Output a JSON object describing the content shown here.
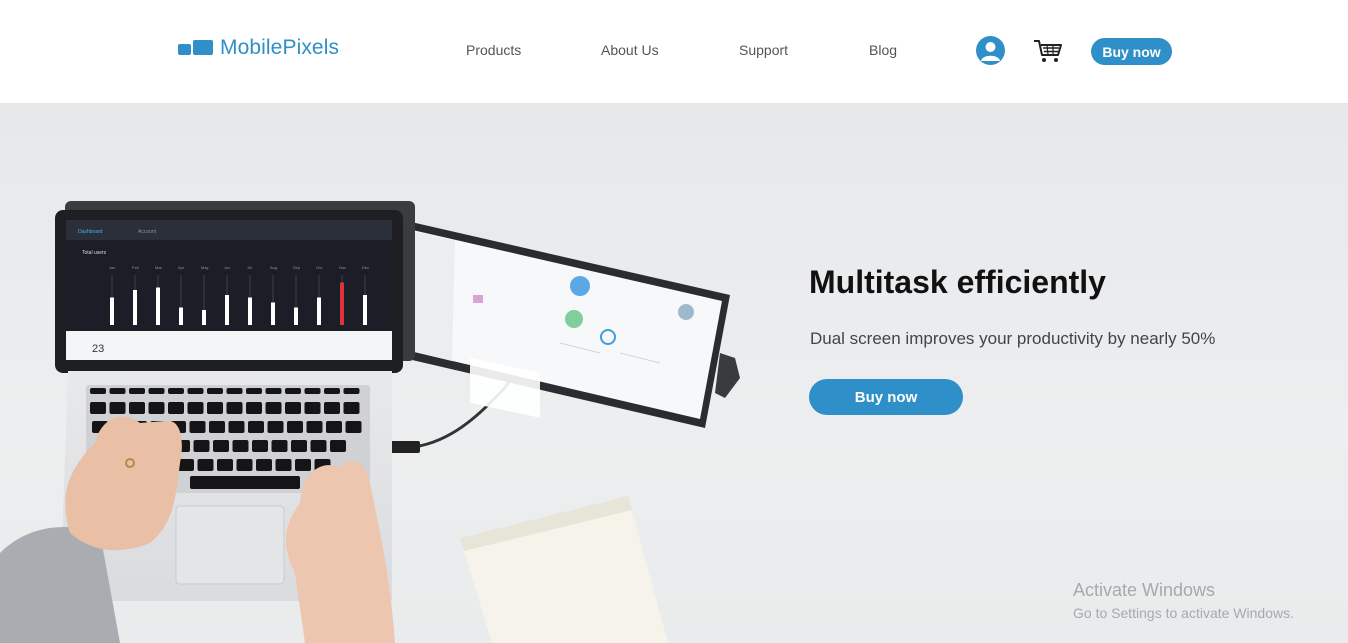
{
  "header": {
    "brand": "MobilePixels",
    "nav": [
      "Products",
      "About Us",
      "Support",
      "Blog"
    ],
    "buy_label": "Buy now"
  },
  "hero": {
    "title": "Multitask efficiently",
    "subtitle": "Dual screen improves your productivity by nearly 50%",
    "cta_label": "Buy now"
  },
  "laptop_screen": {
    "tabs": [
      "Dashboard",
      "Account"
    ],
    "title": "Total users",
    "months": [
      "Jan",
      "Feb",
      "Mar",
      "Apr",
      "May",
      "Jun",
      "Jul",
      "Aug",
      "Sep",
      "Oct",
      "Nov",
      "Dec"
    ],
    "card_value": "23"
  },
  "watermark": {
    "title": "Activate Windows",
    "subtitle": "Go to Settings to activate Windows."
  },
  "colors": {
    "brand": "#2f8fc8",
    "bar_highlight": "#e0323c"
  }
}
